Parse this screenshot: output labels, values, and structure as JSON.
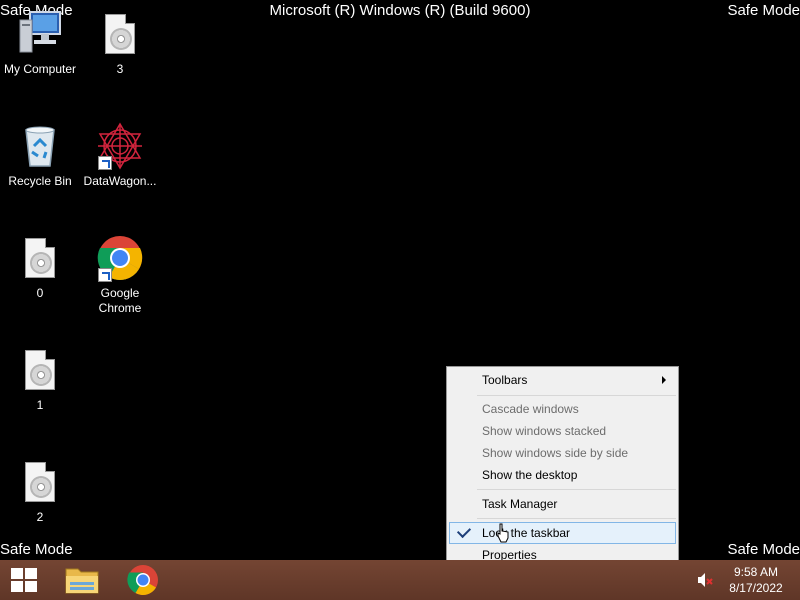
{
  "header": {
    "build": "Microsoft (R) Windows (R) (Build 9600)",
    "safe_mode": "Safe Mode"
  },
  "desktop_icons": [
    {
      "label": "My Computer",
      "icon": "computer-icon"
    },
    {
      "label": "3",
      "icon": "disc-file-icon"
    },
    {
      "label": "Recycle Bin",
      "icon": "recycle-bin-icon"
    },
    {
      "label": "DataWagon...",
      "icon": "datawagon-icon"
    },
    {
      "label": "0",
      "icon": "disc-file-icon"
    },
    {
      "label": "Google Chrome",
      "icon": "chrome-icon"
    },
    {
      "label": "1",
      "icon": "disc-file-icon"
    },
    {
      "label": "2",
      "icon": "disc-file-icon"
    }
  ],
  "context_menu": {
    "items": [
      {
        "label": "Toolbars",
        "enabled": true,
        "submenu": true
      },
      {
        "label": "Cascade windows",
        "enabled": false
      },
      {
        "label": "Show windows stacked",
        "enabled": false
      },
      {
        "label": "Show windows side by side",
        "enabled": false
      },
      {
        "label": "Show the desktop",
        "enabled": true
      },
      {
        "label": "Task Manager",
        "enabled": true
      },
      {
        "label": "Lock the taskbar",
        "enabled": true,
        "checked": true,
        "highlighted": true
      },
      {
        "label": "Properties",
        "enabled": true
      }
    ]
  },
  "taskbar": {
    "pinned": [
      "start-button",
      "file-explorer-icon",
      "chrome-icon"
    ],
    "clock_time": "9:58 AM",
    "clock_date": "8/17/2022",
    "colors": {
      "taskbar": "#6b3e2c",
      "menu_highlight": "#e5f1fb"
    }
  }
}
